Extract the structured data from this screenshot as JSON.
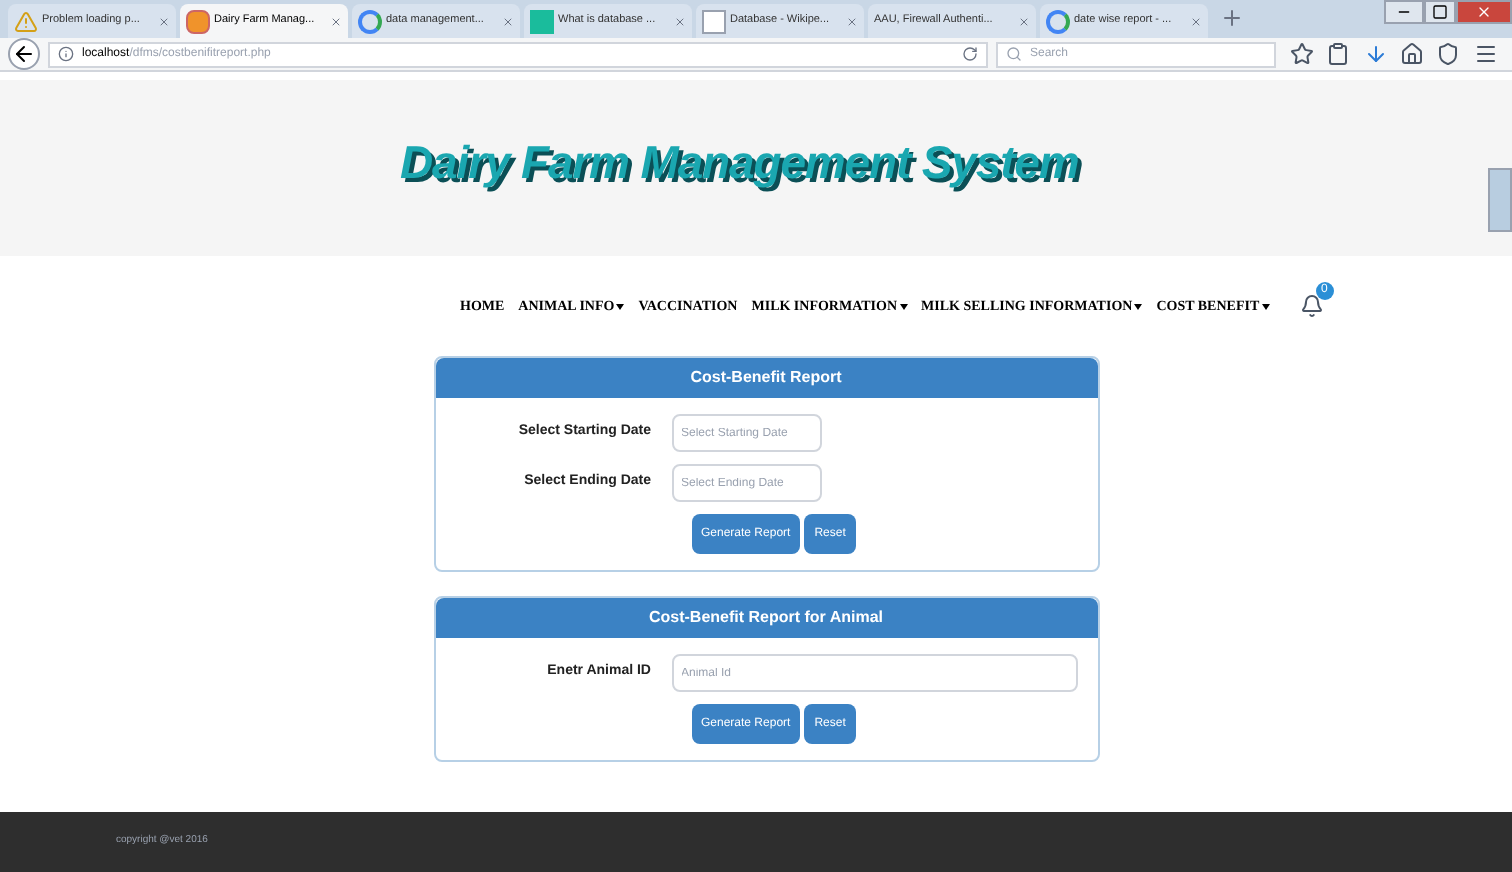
{
  "tabs": [
    {
      "label": "Problem loading p...",
      "kind": "warning",
      "selected": false
    },
    {
      "label": "Dairy Farm Manag...",
      "kind": "orange",
      "selected": true
    },
    {
      "label": "data management...",
      "kind": "google",
      "selected": false
    },
    {
      "label": "What is database ...",
      "kind": "teal",
      "selected": false
    },
    {
      "label": "Database - Wikipe...",
      "kind": "wiki",
      "selected": false
    },
    {
      "label": "AAU, Firewall Authenti...",
      "kind": "none",
      "selected": false
    },
    {
      "label": "date wise report - ...",
      "kind": "google",
      "selected": false
    }
  ],
  "address": {
    "host": "localhost",
    "path": "/dfms/costbenifitreport.php"
  },
  "search": {
    "placeholder": "Search"
  },
  "site_title": "Dairy Farm Management System",
  "nav": [
    {
      "label": "HOME",
      "caret": false
    },
    {
      "label": "ANIMAL INFO",
      "caret": true
    },
    {
      "label": "VACCINATION",
      "caret": false
    },
    {
      "label": "MILK INFORMATION",
      "caret": true
    },
    {
      "label": "MILK SELLING INFORMATION",
      "caret": true
    },
    {
      "label": "COST BENEFIT",
      "caret": true
    }
  ],
  "notifications": {
    "count": "0"
  },
  "panels": [
    {
      "title": "Cost-Benefit Report",
      "fields": [
        {
          "label": "Select Starting Date",
          "placeholder": "Select Starting Date",
          "wide": false
        },
        {
          "label": "Select Ending Date",
          "placeholder": "Select Ending Date",
          "wide": false
        }
      ],
      "buttons": [
        "Generate Report",
        "Reset"
      ]
    },
    {
      "title": "Cost-Benefit Report for Animal",
      "fields": [
        {
          "label": "Enetr Animal ID",
          "placeholder": "Animal Id",
          "wide": true
        }
      ],
      "buttons": [
        "Generate Report",
        "Reset"
      ]
    }
  ],
  "footer": "copyright @vet 2016"
}
